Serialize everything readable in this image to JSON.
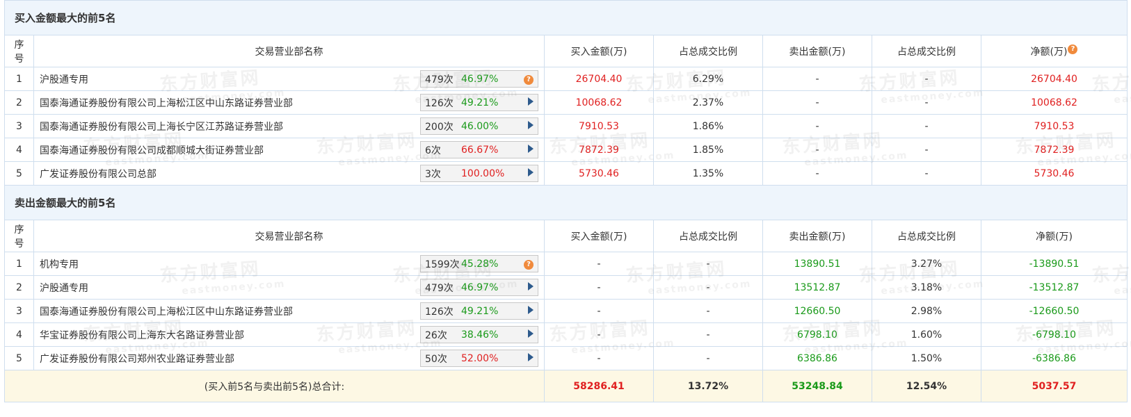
{
  "buy_section": {
    "title": "买入金额最大的前5名",
    "headers": [
      "序号",
      "交易营业部名称",
      "买入金额(万)",
      "占总成交比例",
      "卖出金额(万)",
      "占总成交比例",
      "净额(万)"
    ],
    "rows": [
      {
        "no": "1",
        "name": "沪股通专用",
        "count": "479次",
        "rate": "46.97%",
        "rate_color": "green",
        "icon": "question-icon",
        "buy": "26704.40",
        "buy_ratio": "6.29%",
        "sell": "-",
        "sell_ratio": "-",
        "net": "26704.40"
      },
      {
        "no": "2",
        "name": "国泰海通证券股份有限公司上海松江区中山东路证券营业部",
        "count": "126次",
        "rate": "49.21%",
        "rate_color": "green",
        "icon": "arrow-right-icon",
        "buy": "10068.62",
        "buy_ratio": "2.37%",
        "sell": "-",
        "sell_ratio": "-",
        "net": "10068.62"
      },
      {
        "no": "3",
        "name": "国泰海通证券股份有限公司上海长宁区江苏路证券营业部",
        "count": "200次",
        "rate": "46.00%",
        "rate_color": "green",
        "icon": "arrow-right-icon",
        "buy": "7910.53",
        "buy_ratio": "1.86%",
        "sell": "-",
        "sell_ratio": "-",
        "net": "7910.53"
      },
      {
        "no": "4",
        "name": "国泰海通证券股份有限公司成都顺城大街证券营业部",
        "count": "6次",
        "rate": "66.67%",
        "rate_color": "red",
        "icon": "arrow-right-icon",
        "buy": "7872.39",
        "buy_ratio": "1.85%",
        "sell": "-",
        "sell_ratio": "-",
        "net": "7872.39"
      },
      {
        "no": "5",
        "name": "广发证券股份有限公司总部",
        "count": "3次",
        "rate": "100.00%",
        "rate_color": "red",
        "icon": "arrow-right-icon",
        "buy": "5730.46",
        "buy_ratio": "1.35%",
        "sell": "-",
        "sell_ratio": "-",
        "net": "5730.46"
      }
    ]
  },
  "sell_section": {
    "title": "卖出金额最大的前5名",
    "headers": [
      "序号",
      "交易营业部名称",
      "买入金额(万)",
      "占总成交比例",
      "卖出金额(万)",
      "占总成交比例",
      "净额(万)"
    ],
    "rows": [
      {
        "no": "1",
        "name": "机构专用",
        "count": "1599次",
        "rate": "45.28%",
        "rate_color": "green",
        "icon": "question-icon",
        "buy": "-",
        "buy_ratio": "-",
        "sell": "13890.51",
        "sell_ratio": "3.27%",
        "net": "-13890.51"
      },
      {
        "no": "2",
        "name": "沪股通专用",
        "count": "479次",
        "rate": "46.97%",
        "rate_color": "green",
        "icon": "arrow-right-icon",
        "buy": "-",
        "buy_ratio": "-",
        "sell": "13512.87",
        "sell_ratio": "3.18%",
        "net": "-13512.87"
      },
      {
        "no": "3",
        "name": "国泰海通证券股份有限公司上海松江区中山东路证券营业部",
        "count": "126次",
        "rate": "49.21%",
        "rate_color": "green",
        "icon": "arrow-right-icon",
        "buy": "-",
        "buy_ratio": "-",
        "sell": "12660.50",
        "sell_ratio": "2.98%",
        "net": "-12660.50"
      },
      {
        "no": "4",
        "name": "华宝证券股份有限公司上海东大名路证券营业部",
        "count": "26次",
        "rate": "38.46%",
        "rate_color": "green",
        "icon": "arrow-right-icon",
        "buy": "-",
        "buy_ratio": "-",
        "sell": "6798.10",
        "sell_ratio": "1.60%",
        "net": "-6798.10"
      },
      {
        "no": "5",
        "name": "广发证券股份有限公司郑州农业路证券营业部",
        "count": "50次",
        "rate": "52.00%",
        "rate_color": "red",
        "icon": "arrow-right-icon",
        "buy": "-",
        "buy_ratio": "-",
        "sell": "6386.86",
        "sell_ratio": "1.50%",
        "net": "-6386.86"
      }
    ]
  },
  "total": {
    "label": "(买入前5名与卖出前5名)总合计:",
    "buy": "58286.41",
    "buy_ratio": "13.72%",
    "sell": "53248.84",
    "sell_ratio": "12.54%",
    "net": "5037.57"
  },
  "watermark": {
    "cn": "东方财富网",
    "en": "eastmoney.com"
  },
  "colors": {
    "red": "#e02020",
    "green": "#1a9a1a",
    "header_bg": "#eef5fc",
    "total_bg": "#fdf8e4",
    "border": "#cfdeee",
    "question_icon": "#f08a3c",
    "arrow_icon": "#2d5a8c"
  }
}
